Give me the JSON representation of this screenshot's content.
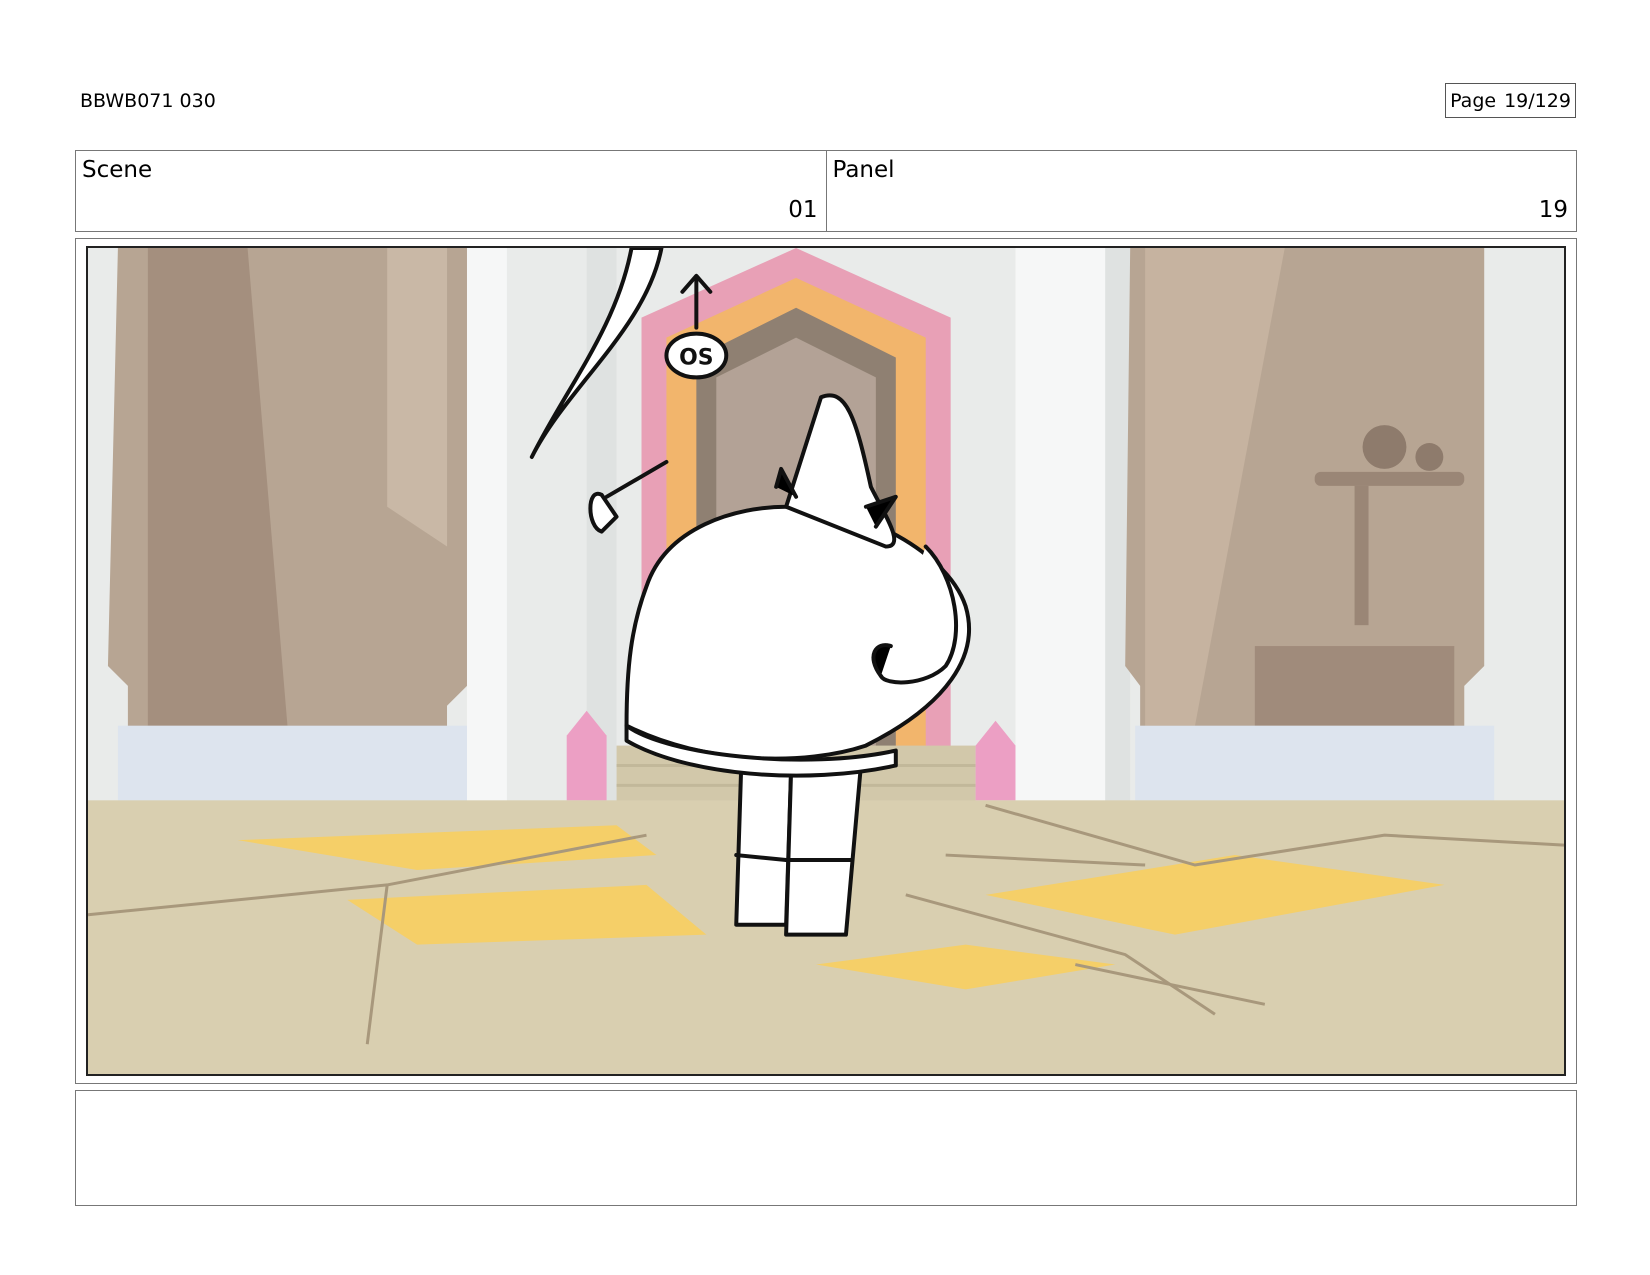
{
  "document": {
    "id": "BBWB071 030",
    "page_label": "Page",
    "page_value": "19/129"
  },
  "header": {
    "scene_label": "Scene",
    "scene_value": "01",
    "panel_label": "Panel",
    "panel_value": "19"
  },
  "panel_art": {
    "sketch_note": "OS"
  },
  "colors": {
    "wall": "#e9ebea",
    "floor": "#d9cfb0",
    "floor_tile": "#f5cf68",
    "rock": "#b7a593",
    "rock_dark": "#9a8676",
    "door_pink": "#e8a0b6",
    "door_orange": "#f2b56c",
    "crystal": "#ec9fc4"
  }
}
